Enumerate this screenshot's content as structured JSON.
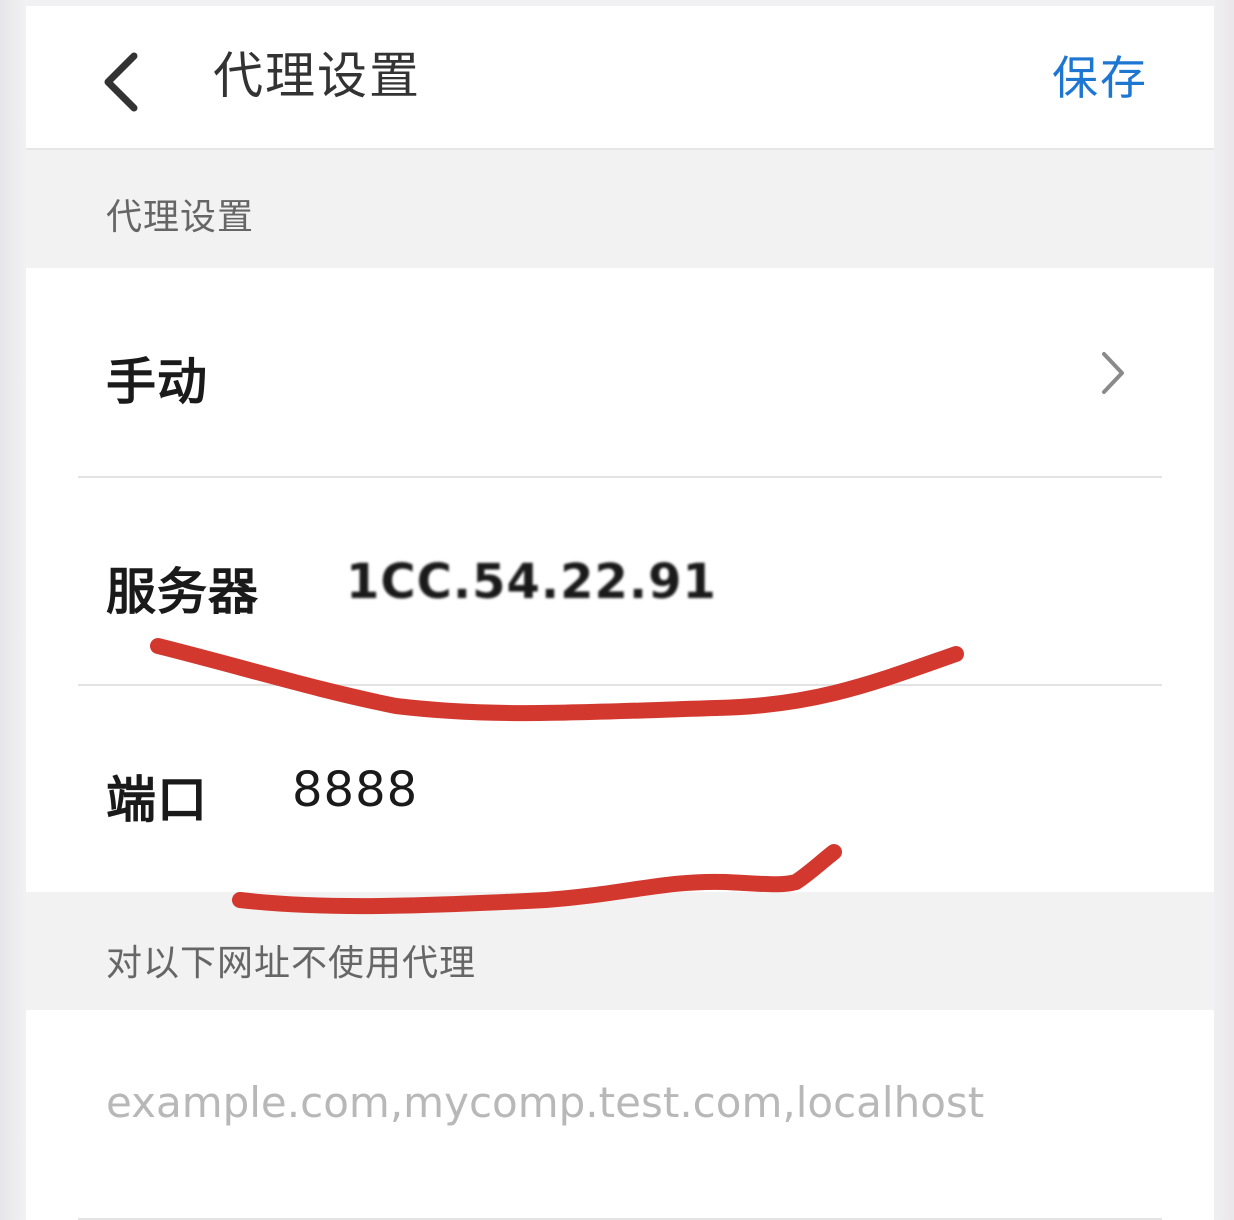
{
  "header": {
    "title": "代理设置",
    "save_label": "保存"
  },
  "section_proxy": {
    "title": "代理设置"
  },
  "proxy_mode": {
    "value": "手动"
  },
  "server": {
    "label": "服务器",
    "value": "1CC.54.22.91"
  },
  "port": {
    "label": "端口",
    "value": "8888"
  },
  "section_bypass": {
    "title": "对以下网址不使用代理"
  },
  "bypass": {
    "placeholder": "example.com,mycomp.test.com,localhost"
  },
  "colors": {
    "accent": "#1d76d2",
    "annotation": "#d3382e"
  }
}
